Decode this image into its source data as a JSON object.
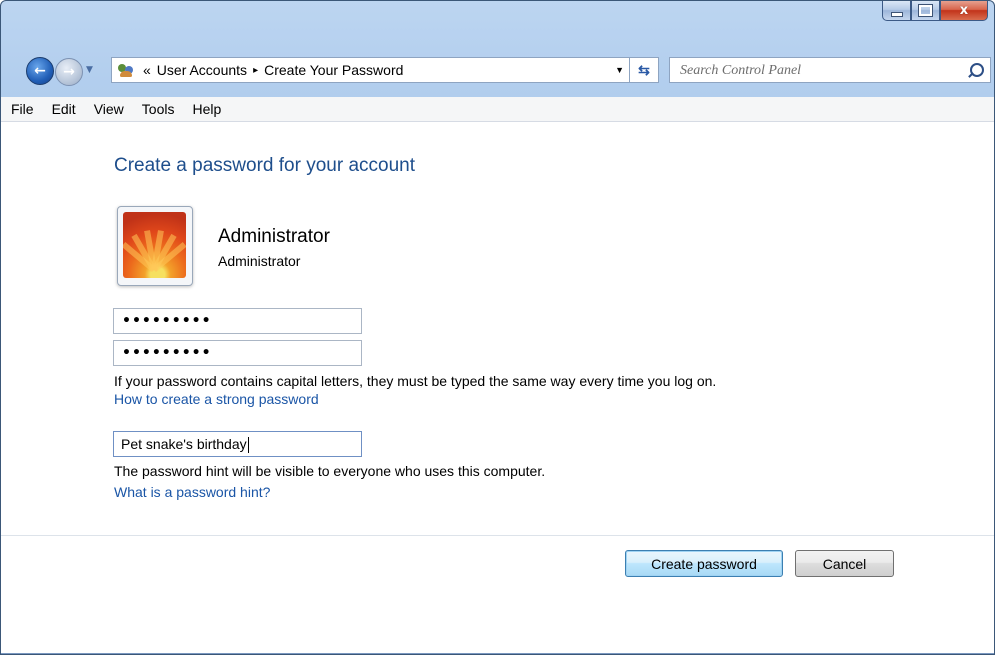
{
  "window": {
    "caption_buttons": {
      "minimize": "minimize",
      "maximize": "maximize",
      "close": "x"
    }
  },
  "navbar": {
    "back_icon": "back-arrow-icon",
    "forward_icon": "forward-arrow-icon",
    "address": {
      "prefix": "«",
      "crumbs": [
        "User Accounts",
        "Create Your Password"
      ],
      "separator": "▸"
    },
    "search_placeholder": "Search Control Panel"
  },
  "menubar": {
    "items": [
      "File",
      "Edit",
      "View",
      "Tools",
      "Help"
    ]
  },
  "main": {
    "title": "Create a password for your account",
    "user": {
      "name": "Administrator",
      "role": "Administrator"
    },
    "password_mask": "•••••••••",
    "confirm_mask": "•••••••••",
    "caps_note": "If your password contains capital letters, they must be typed the same way every time you log on.",
    "strong_password_link": "How to create a strong password",
    "hint_value": "Pet snake's birthday",
    "hint_note": "The password hint will be visible to everyone who uses this computer.",
    "hint_link": "What is a password hint?"
  },
  "actions": {
    "create_label": "Create password",
    "cancel_label": "Cancel"
  },
  "colors": {
    "title_blue": "#1e4e8c",
    "link_blue": "#1a55a6",
    "frame_blue": "#a9c8ea"
  }
}
